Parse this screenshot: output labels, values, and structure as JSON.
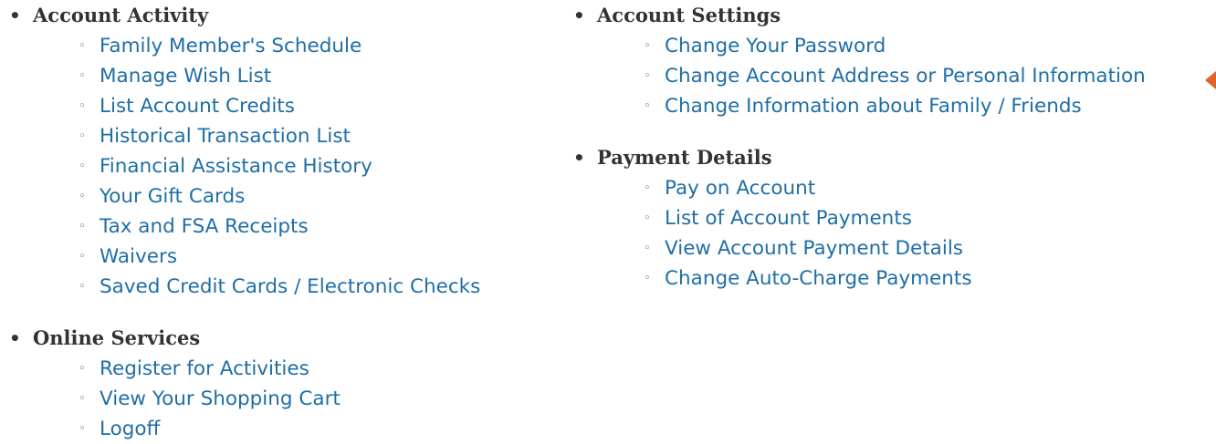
{
  "sections": {
    "account_activity": {
      "title": "Account Activity",
      "items": [
        "Family Member's Schedule",
        "Manage Wish List",
        "List Account Credits",
        "Historical Transaction List",
        "Financial Assistance History",
        "Your Gift Cards",
        "Tax and FSA Receipts",
        "Waivers",
        "Saved Credit Cards / Electronic Checks"
      ]
    },
    "online_services": {
      "title": "Online Services",
      "items": [
        "Register for Activities",
        "View Your Shopping Cart",
        "Logoff"
      ]
    },
    "account_settings": {
      "title": "Account Settings",
      "items": [
        "Change Your Password",
        "Change Account Address or Personal Information",
        "Change Information about Family / Friends"
      ]
    },
    "payment_details": {
      "title": "Payment Details",
      "items": [
        "Pay on Account",
        "List of Account Payments",
        "View Account Payment Details",
        "Change Auto-Charge Payments"
      ]
    }
  },
  "icons": {
    "pointer": "pointer-arrow-icon"
  },
  "colors": {
    "link": "#1f6ea6",
    "heading": "#333333",
    "pointer": "#e0632a"
  }
}
